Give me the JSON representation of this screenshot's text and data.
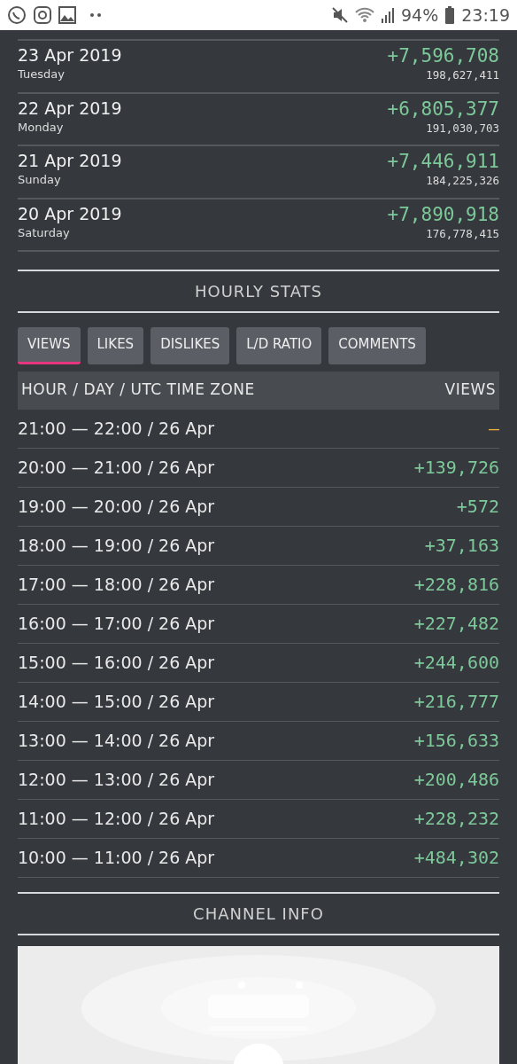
{
  "status_bar": {
    "battery": "94%",
    "time": "23:19"
  },
  "daily": [
    {
      "date": "23 Apr 2019",
      "weekday": "Tuesday",
      "change": "+7,596,708",
      "total": "198,627,411"
    },
    {
      "date": "22 Apr 2019",
      "weekday": "Monday",
      "change": "+6,805,377",
      "total": "191,030,703"
    },
    {
      "date": "21 Apr 2019",
      "weekday": "Sunday",
      "change": "+7,446,911",
      "total": "184,225,326"
    },
    {
      "date": "20 Apr 2019",
      "weekday": "Saturday",
      "change": "+7,890,918",
      "total": "176,778,415"
    }
  ],
  "hourly_title": "HOURLY STATS",
  "tabs": [
    {
      "label": "VIEWS",
      "selected": true
    },
    {
      "label": "LIKES",
      "selected": false
    },
    {
      "label": "DISLIKES",
      "selected": false
    },
    {
      "label": "L/D RATIO",
      "selected": false
    },
    {
      "label": "COMMENTS",
      "selected": false
    }
  ],
  "table": {
    "columns": [
      "HOUR / DAY / UTC TIME ZONE",
      "VIEWS"
    ],
    "rows": [
      {
        "hour": "21:00 — 22:00 / 26 Apr",
        "value": "–",
        "kind": "empty"
      },
      {
        "hour": "20:00 — 21:00 / 26 Apr",
        "value": "+139,726",
        "kind": "gain"
      },
      {
        "hour": "19:00 — 20:00 / 26 Apr",
        "value": "+572",
        "kind": "gain"
      },
      {
        "hour": "18:00 — 19:00 / 26 Apr",
        "value": "+37,163",
        "kind": "gain"
      },
      {
        "hour": "17:00 — 18:00 / 26 Apr",
        "value": "+228,816",
        "kind": "gain"
      },
      {
        "hour": "16:00 — 17:00 / 26 Apr",
        "value": "+227,482",
        "kind": "gain"
      },
      {
        "hour": "15:00 — 16:00 / 26 Apr",
        "value": "+244,600",
        "kind": "gain"
      },
      {
        "hour": "14:00 — 15:00 / 26 Apr",
        "value": "+216,777",
        "kind": "gain"
      },
      {
        "hour": "13:00 — 14:00 / 26 Apr",
        "value": "+156,633",
        "kind": "gain"
      },
      {
        "hour": "12:00 — 13:00 / 26 Apr",
        "value": "+200,486",
        "kind": "gain"
      },
      {
        "hour": "11:00 — 12:00 / 26 Apr",
        "value": "+228,232",
        "kind": "gain"
      },
      {
        "hour": "10:00 — 11:00 / 26 Apr",
        "value": "+484,302",
        "kind": "gain"
      }
    ]
  },
  "channel_title": "CHANNEL INFO"
}
